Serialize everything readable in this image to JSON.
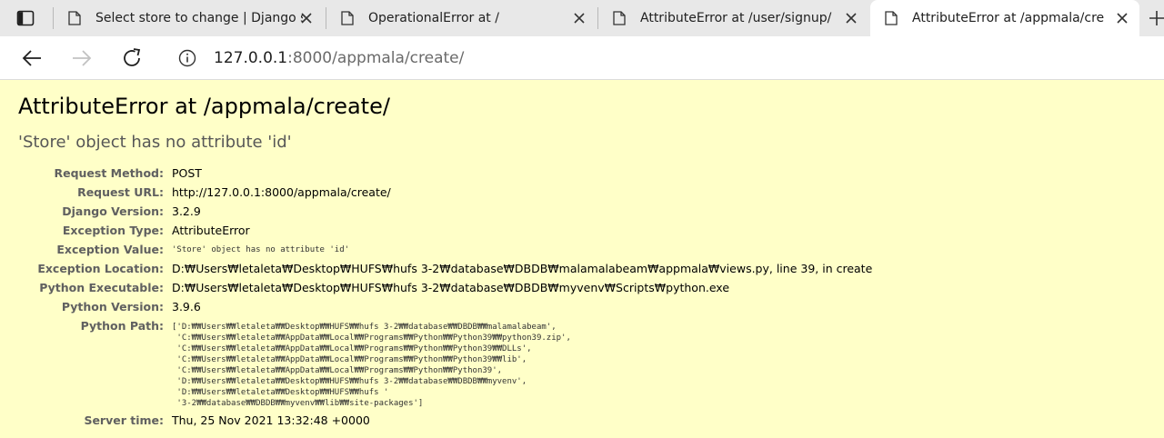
{
  "browser": {
    "tabs": [
      {
        "title": "Select store to change | Django site admin"
      },
      {
        "title": "OperationalError at /"
      },
      {
        "title": "AttributeError at /user/signup/"
      },
      {
        "title": "AttributeError at /appmala/create/"
      }
    ],
    "url_host": "127.0.0.1",
    "url_rest": ":8000/appmala/create/"
  },
  "page": {
    "heading": "AttributeError at /appmala/create/",
    "subheading": "'Store' object has no attribute 'id'",
    "meta": [
      {
        "key": "Request Method:",
        "value": "POST"
      },
      {
        "key": "Request URL:",
        "value": "http://127.0.0.1:8000/appmala/create/"
      },
      {
        "key": "Django Version:",
        "value": "3.2.9"
      },
      {
        "key": "Exception Type:",
        "value": "AttributeError"
      },
      {
        "key": "Exception Value:",
        "value": "'Store' object has no attribute 'id'"
      },
      {
        "key": "Exception Location:",
        "value": "D:₩Users₩letaleta₩Desktop₩HUFS₩hufs 3-2₩database₩DBDB₩malamalabeam₩appmala₩views.py, line 39, in create"
      },
      {
        "key": "Python Executable:",
        "value": "D:₩Users₩letaleta₩Desktop₩HUFS₩hufs 3-2₩database₩DBDB₩myvenv₩Scripts₩python.exe"
      },
      {
        "key": "Python Version:",
        "value": "3.9.6"
      },
      {
        "key": "Python Path:",
        "value": ""
      },
      {
        "key": "Server time:",
        "value": "Thu, 25 Nov 2021 13:32:48 +0000"
      }
    ],
    "python_path_lines": [
      "['D:₩₩Users₩₩letaleta₩₩Desktop₩₩HUFS₩₩hufs 3-2₩₩database₩₩DBDB₩₩malamalabeam',",
      " 'C:₩₩Users₩₩letaleta₩₩AppData₩₩Local₩₩Programs₩₩Python₩₩Python39₩₩python39.zip',",
      " 'C:₩₩Users₩₩letaleta₩₩AppData₩₩Local₩₩Programs₩₩Python₩₩Python39₩₩DLLs',",
      " 'C:₩₩Users₩₩letaleta₩₩AppData₩₩Local₩₩Programs₩₩Python₩₩Python39₩₩lib',",
      " 'C:₩₩Users₩₩letaleta₩₩AppData₩₩Local₩₩Programs₩₩Python₩₩Python39',",
      " 'D:₩₩Users₩₩letaleta₩₩Desktop₩₩HUFS₩₩hufs 3-2₩₩database₩₩DBDB₩₩myvenv',",
      " 'D:₩₩Users₩₩letaleta₩₩Desktop₩₩HUFS₩₩hufs '",
      " '3-2₩₩database₩₩DBDB₩₩myvenv₩₩lib₩₩site-packages']"
    ]
  }
}
